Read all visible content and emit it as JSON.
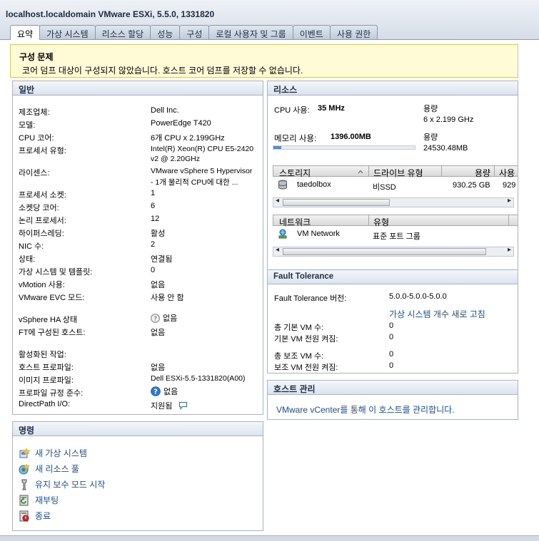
{
  "window": {
    "title": "localhost.localdomain VMware ESXi, 5.5.0, 1331820",
    "tabs": [
      "요약",
      "가상 시스템",
      "리소스 할당",
      "성능",
      "구성",
      "로컬 사용자 및 그룹",
      "이벤트",
      "사용 권한"
    ],
    "active_tab": 0
  },
  "config_issue": {
    "heading": "구성 문제",
    "message": "코어 덤프 대상이 구성되지 않았습니다. 호스트 코어 덤프를 저장할 수 없습니다."
  },
  "general": {
    "title": "일반",
    "rows": [
      {
        "label": "제조업체:",
        "value": "Dell Inc."
      },
      {
        "label": "모델:",
        "value": "PowerEdge T420"
      },
      {
        "label": "CPU 코어:",
        "value": "6개 CPU x 2.199GHz"
      },
      {
        "label": "프로세서 유형:",
        "value": "Intel(R) Xeon(R) CPU E5-2420",
        "value2": "v2 @ 2.20GHz"
      },
      {
        "label": "라이센스:",
        "value": "VMware vSphere 5 Hypervisor",
        "value2": "- 1개 물리적 CPU에 대한 ..."
      },
      {
        "label": "프로세서 소켓:",
        "value": "1"
      },
      {
        "label": "소켓당 코어:",
        "value": "6"
      },
      {
        "label": "논리 프로세서:",
        "value": "12"
      },
      {
        "label": "하이퍼스레딩:",
        "value": "활성"
      },
      {
        "label": "NIC 수:",
        "value": "2"
      },
      {
        "label": "상태:",
        "value": "연결됨"
      },
      {
        "label": "가상 시스템 및 템플릿:",
        "value": "0"
      },
      {
        "label": "vMotion 사용:",
        "value": "없음"
      },
      {
        "label": "VMware EVC 모드:",
        "value": "사용 안 함"
      },
      {
        "label": "vSphere HA 상태",
        "value": "없음"
      },
      {
        "label": "FT에 구성된 호스트:",
        "value": "없음"
      },
      {
        "label": "활성화된 작업:",
        "value": ""
      },
      {
        "label": "호스트 프로파일:",
        "value": "없음"
      },
      {
        "label": "이미지 프로파일:",
        "value": "Dell ESXi-5.5-1331820(A00)"
      },
      {
        "label": "프로파일 규정 준수:",
        "value": "없음"
      },
      {
        "label": "DirectPath I/O:",
        "value": "지원됨"
      }
    ]
  },
  "commands": {
    "title": "명령",
    "items": [
      {
        "label": "새 가상 시스템",
        "icon": "new-vm-icon"
      },
      {
        "label": "새 리소스 풀",
        "icon": "new-resource-pool-icon"
      },
      {
        "label": "유지 보수 모드 시작",
        "icon": "maintenance-mode-icon"
      },
      {
        "label": "재부팅",
        "icon": "reboot-icon"
      },
      {
        "label": "종료",
        "icon": "shutdown-icon"
      }
    ]
  },
  "resources": {
    "title": "리소스",
    "cpu_label": "CPU 사용:",
    "cpu_value": "35 MHz",
    "cpu_capacity_label": "용량",
    "cpu_capacity": "6 x 2.199 GHz",
    "memory_label": "메모리 사용:",
    "memory_value": "1396.00MB",
    "memory_capacity_label": "용량",
    "memory_capacity": "24530.48MB",
    "memory_usage_fraction": 0.057,
    "storage_headers": [
      "스토리지",
      "드라이브 유형",
      "용량",
      "사용"
    ],
    "storage_rows": [
      {
        "name": "taedolbox",
        "drive_type": "비SSD",
        "capacity": "930.25 GB",
        "free": "929"
      }
    ],
    "network_headers": [
      "네트워크",
      "유형"
    ],
    "network_rows": [
      {
        "name": "VM Network",
        "type": "표준 포트 그룹"
      }
    ]
  },
  "fault_tolerance": {
    "title": "Fault Tolerance",
    "version_label": "Fault Tolerance 버전:",
    "version_value": "5.0.0-5.0.0-5.0.0",
    "refresh_link": "가상 시스템 개수 새로 고침",
    "rows": [
      {
        "label": "총 기본 VM 수:",
        "value": "0"
      },
      {
        "label": "기본 VM 전원 켜짐:",
        "value": "0"
      },
      {
        "label": "총 보조 VM 수:",
        "value": "0"
      },
      {
        "label": "보조 VM 전원 켜짐:",
        "value": "0"
      }
    ]
  },
  "host_management": {
    "title": "호스트 관리",
    "link": "VMware vCenter를 통해 이 호스트를 관리합니다."
  },
  "colors": {
    "link": "#1a4fa0",
    "panel_border": "#a7b4c6",
    "warning_bg": "#fffbd6",
    "usage_bar": "#4a90d6"
  }
}
